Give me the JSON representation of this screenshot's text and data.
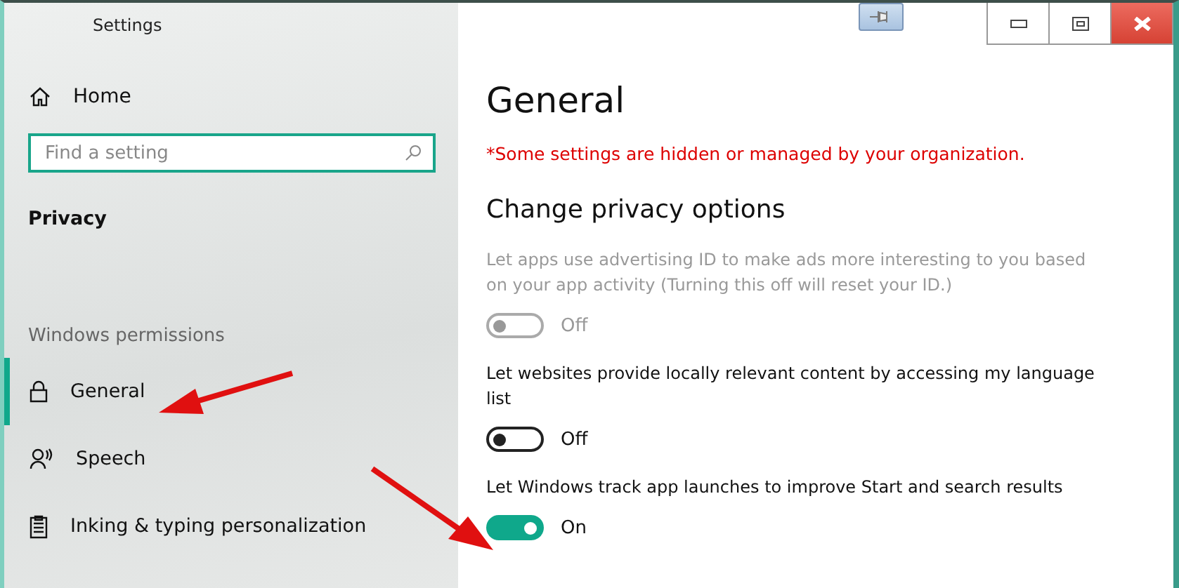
{
  "window": {
    "title": "Settings"
  },
  "sidebar": {
    "home": "Home",
    "search": {
      "placeholder": "Find a setting"
    },
    "section": "Privacy",
    "group": "Windows permissions",
    "items": [
      {
        "label": "General",
        "kind": "lock",
        "selected": true
      },
      {
        "label": "Speech",
        "kind": "speech",
        "selected": false
      },
      {
        "label": "Inking & typing personalization",
        "kind": "clipboard",
        "selected": false
      }
    ]
  },
  "page": {
    "title": "General",
    "notice": "*Some settings are hidden or managed by your organization.",
    "section": "Change privacy options",
    "settings": [
      {
        "text": "Let apps use advertising ID to make ads more interesting to you based on your app activity (Turning this off will reset your ID.)",
        "state": "Off",
        "on": false,
        "disabled": true
      },
      {
        "text": "Let websites provide locally relevant content by accessing my language list",
        "state": "Off",
        "on": false,
        "disabled": false
      },
      {
        "text": "Let Windows track app launches to improve Start and search results",
        "state": "On",
        "on": true,
        "disabled": false
      }
    ]
  }
}
